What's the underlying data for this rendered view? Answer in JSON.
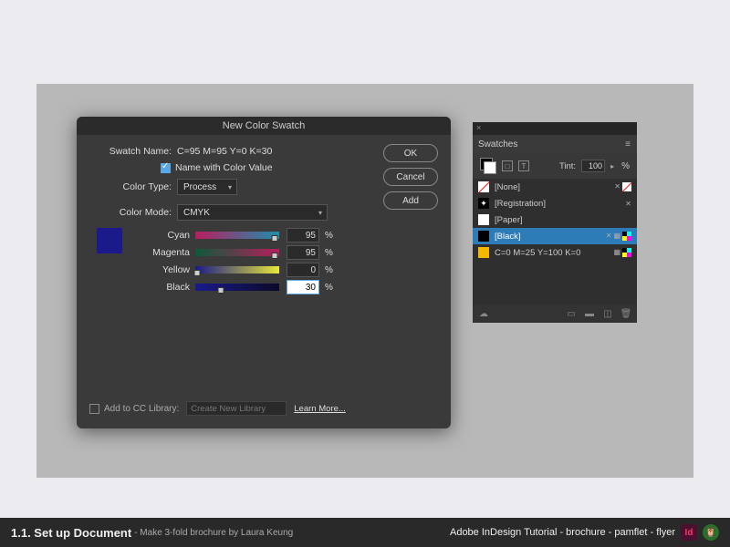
{
  "dialog": {
    "title": "New Color Swatch",
    "swatch_name_lbl": "Swatch Name:",
    "swatch_name_val": "C=95 M=95 Y=0 K=30",
    "name_with_value": "Name with Color Value",
    "color_type_lbl": "Color Type:",
    "color_type_val": "Process",
    "color_mode_lbl": "Color Mode:",
    "color_mode_val": "CMYK",
    "sliders": {
      "cyan_lbl": "Cyan",
      "cyan_val": "95",
      "magenta_lbl": "Magenta",
      "magenta_val": "95",
      "yellow_lbl": "Yellow",
      "yellow_val": "0",
      "black_lbl": "Black",
      "black_val": "30"
    },
    "pct": "%",
    "add_to_lib": "Add to CC Library:",
    "lib_placeholder": "Create New Library",
    "learn_more": "Learn More...",
    "buttons": {
      "ok": "OK",
      "cancel": "Cancel",
      "add": "Add"
    }
  },
  "panel": {
    "title": "Swatches",
    "tint_lbl": "Tint:",
    "tint_val": "100",
    "items": [
      {
        "name": "[None]"
      },
      {
        "name": "[Registration]"
      },
      {
        "name": "[Paper]"
      },
      {
        "name": "[Black]"
      },
      {
        "name": "C=0 M=25 Y=100 K=0"
      }
    ]
  },
  "caption": {
    "step": "1.1. Set up Document",
    "subtitle": " - Make 3-fold brochure by Laura Keung",
    "right": "Adobe InDesign Tutorial - brochure - pamflet - flyer",
    "id": "Id"
  }
}
